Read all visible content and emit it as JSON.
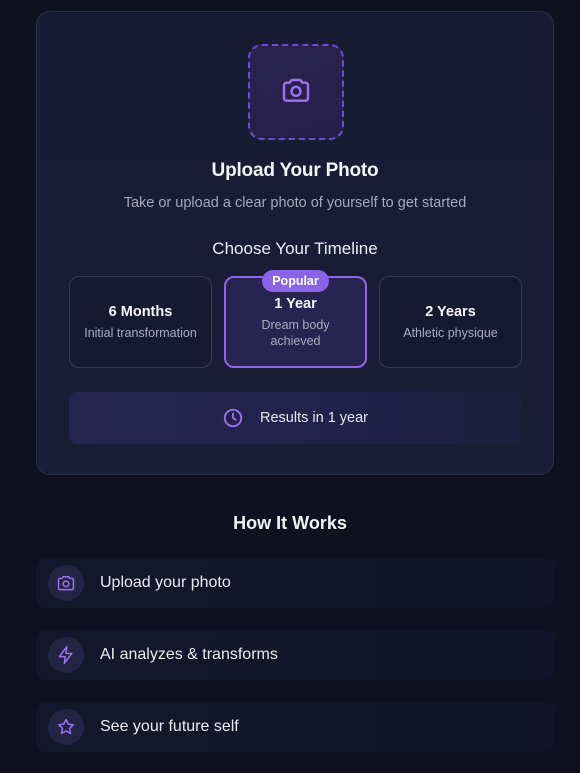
{
  "upload": {
    "title": "Upload Your Photo",
    "subtitle": "Take or upload a clear photo of yourself to get started",
    "icon": "camera-icon"
  },
  "timeline": {
    "title": "Choose Your Timeline",
    "badge": "Popular",
    "selected_index": 1,
    "options": [
      {
        "title": "6 Months",
        "subtitle": "Initial transformation"
      },
      {
        "title": "1 Year",
        "subtitle": "Dream body achieved"
      },
      {
        "title": "2 Years",
        "subtitle": "Athletic physique"
      }
    ]
  },
  "results": {
    "text": "Results in 1 year",
    "icon": "clock-icon"
  },
  "how_it_works": {
    "title": "How It Works",
    "steps": [
      {
        "label": "Upload your photo",
        "icon": "camera-icon"
      },
      {
        "label": "AI analyzes & transforms",
        "icon": "lightning-icon"
      },
      {
        "label": "See your future self",
        "icon": "star-icon"
      }
    ]
  },
  "colors": {
    "background": "#0f1121",
    "accent": "#8a63e6",
    "card": "#181b31"
  }
}
